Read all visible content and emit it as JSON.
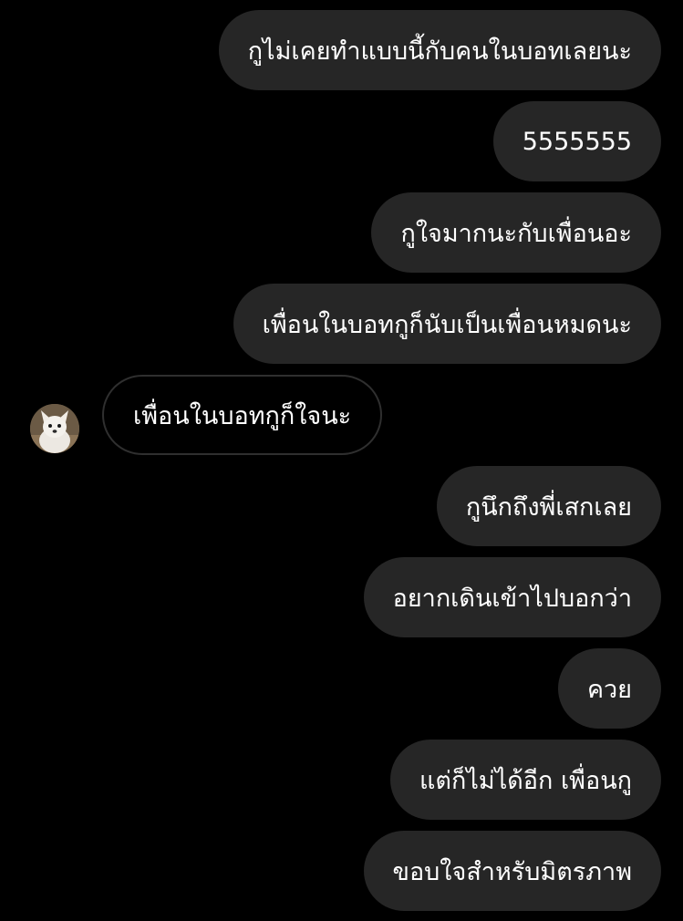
{
  "conversation": {
    "messages": [
      {
        "direction": "outgoing",
        "text": "กูไม่เคยทำแบบนี้กับคนในบอทเลยนะ"
      },
      {
        "direction": "outgoing",
        "text": "5555555"
      },
      {
        "direction": "outgoing",
        "text": "กูใจมากนะกับเพื่อนอะ"
      },
      {
        "direction": "outgoing",
        "text": "เพื่อนในบอทกูก็นับเป็นเพื่อนหมดนะ"
      },
      {
        "direction": "incoming",
        "text": "เพื่อนในบอทกูก็ใจนะ"
      },
      {
        "direction": "outgoing",
        "text": "กูนึกถึงพี่เสกเลย"
      },
      {
        "direction": "outgoing",
        "text": "อยากเดินเข้าไปบอกว่า"
      },
      {
        "direction": "outgoing",
        "text": "ควย"
      },
      {
        "direction": "outgoing",
        "text": "แต่ก็ไม่ได้อีก เพื่อนกู"
      },
      {
        "direction": "outgoing",
        "text": "ขอบใจสำหรับมิตรภาพ"
      }
    ]
  },
  "colors": {
    "background": "#000000",
    "outgoing_bubble": "#262626",
    "incoming_border": "#2f2f2f",
    "text": "#ffffff"
  },
  "icons": {
    "avatar": "sender-avatar-dog-photo"
  }
}
